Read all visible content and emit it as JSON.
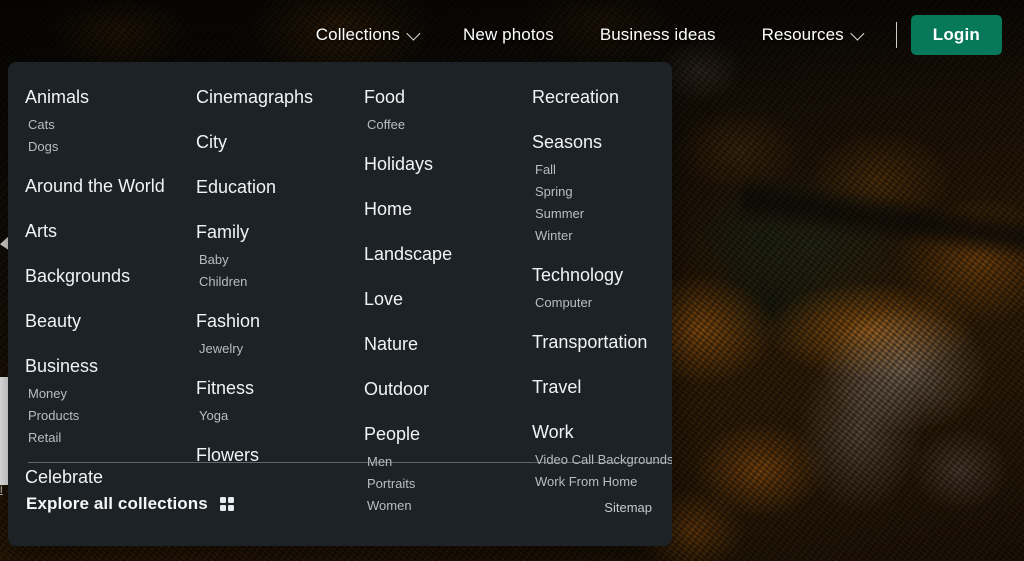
{
  "topnav": {
    "items": [
      {
        "label": "Collections",
        "has_chevron": true,
        "active": true
      },
      {
        "label": "New photos",
        "has_chevron": false,
        "active": false
      },
      {
        "label": "Business ideas",
        "has_chevron": false,
        "active": false
      },
      {
        "label": "Resources",
        "has_chevron": true,
        "active": false
      }
    ],
    "login_label": "Login"
  },
  "mega_menu": {
    "columns": [
      {
        "groups": [
          {
            "title": "Animals",
            "subitems": [
              "Cats",
              "Dogs"
            ]
          },
          {
            "title": "Around the World",
            "subitems": []
          },
          {
            "title": "Arts",
            "subitems": []
          },
          {
            "title": "Backgrounds",
            "subitems": []
          },
          {
            "title": "Beauty",
            "subitems": []
          },
          {
            "title": "Business",
            "subitems": [
              "Money",
              "Products",
              "Retail"
            ]
          },
          {
            "title": "Celebrate",
            "subitems": []
          }
        ]
      },
      {
        "groups": [
          {
            "title": "Cinemagraphs",
            "subitems": []
          },
          {
            "title": "City",
            "subitems": []
          },
          {
            "title": "Education",
            "subitems": []
          },
          {
            "title": "Family",
            "subitems": [
              "Baby",
              "Children"
            ]
          },
          {
            "title": "Fashion",
            "subitems": [
              "Jewelry"
            ]
          },
          {
            "title": "Fitness",
            "subitems": [
              "Yoga"
            ]
          },
          {
            "title": "Flowers",
            "subitems": []
          }
        ]
      },
      {
        "groups": [
          {
            "title": "Food",
            "subitems": [
              "Coffee"
            ]
          },
          {
            "title": "Holidays",
            "subitems": []
          },
          {
            "title": "Home",
            "subitems": []
          },
          {
            "title": "Landscape",
            "subitems": []
          },
          {
            "title": "Love",
            "subitems": []
          },
          {
            "title": "Nature",
            "subitems": []
          },
          {
            "title": "Outdoor",
            "subitems": []
          },
          {
            "title": "People",
            "subitems": [
              "Men",
              "Portraits",
              "Women"
            ]
          }
        ]
      },
      {
        "groups": [
          {
            "title": "Recreation",
            "subitems": []
          },
          {
            "title": "Seasons",
            "subitems": [
              "Fall",
              "Spring",
              "Summer",
              "Winter"
            ]
          },
          {
            "title": "Technology",
            "subitems": [
              "Computer"
            ]
          },
          {
            "title": "Transportation",
            "subitems": []
          },
          {
            "title": "Travel",
            "subitems": []
          },
          {
            "title": "Work",
            "subitems": [
              "Video Call Backgrounds",
              "Work From Home"
            ]
          }
        ]
      }
    ],
    "footer": {
      "explore_label": "Explore all collections",
      "explore_icon": "grid-icon",
      "sitemap_label": "Sitemap"
    }
  },
  "background": {
    "description": "aerial-autumn-forest-photo",
    "peek_link_text": "i"
  },
  "colors": {
    "panel_bg": "#1c2226",
    "login_green": "#07795a",
    "title_text": "#f1f3f4",
    "sub_text": "#b8bdc0"
  }
}
